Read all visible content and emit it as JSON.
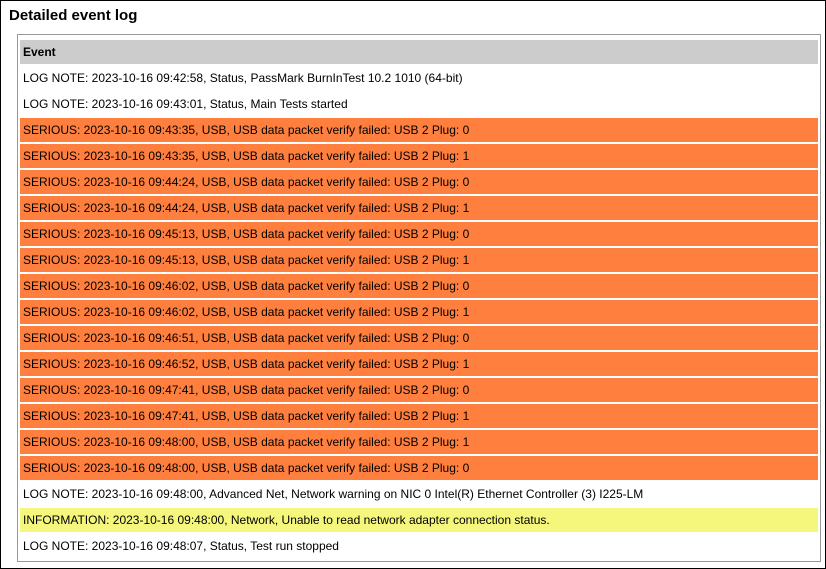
{
  "title": "Detailed event log",
  "table": {
    "header": "Event",
    "rows": [
      {
        "severity": "note",
        "text": "LOG NOTE: 2023-10-16 09:42:58, Status, PassMark BurnInTest 10.2 1010 (64-bit)"
      },
      {
        "severity": "note",
        "text": "LOG NOTE: 2023-10-16 09:43:01, Status, Main Tests started"
      },
      {
        "severity": "serious",
        "text": "SERIOUS: 2023-10-16 09:43:35, USB, USB data packet verify failed: USB 2 Plug: 0"
      },
      {
        "severity": "serious",
        "text": "SERIOUS: 2023-10-16 09:43:35, USB, USB data packet verify failed: USB 2 Plug: 1"
      },
      {
        "severity": "serious",
        "text": "SERIOUS: 2023-10-16 09:44:24, USB, USB data packet verify failed: USB 2 Plug: 0"
      },
      {
        "severity": "serious",
        "text": "SERIOUS: 2023-10-16 09:44:24, USB, USB data packet verify failed: USB 2 Plug: 1"
      },
      {
        "severity": "serious",
        "text": "SERIOUS: 2023-10-16 09:45:13, USB, USB data packet verify failed: USB 2 Plug: 0"
      },
      {
        "severity": "serious",
        "text": "SERIOUS: 2023-10-16 09:45:13, USB, USB data packet verify failed: USB 2 Plug: 1"
      },
      {
        "severity": "serious",
        "text": "SERIOUS: 2023-10-16 09:46:02, USB, USB data packet verify failed: USB 2 Plug: 0"
      },
      {
        "severity": "serious",
        "text": "SERIOUS: 2023-10-16 09:46:02, USB, USB data packet verify failed: USB 2 Plug: 1"
      },
      {
        "severity": "serious",
        "text": "SERIOUS: 2023-10-16 09:46:51, USB, USB data packet verify failed: USB 2 Plug: 0"
      },
      {
        "severity": "serious",
        "text": "SERIOUS: 2023-10-16 09:46:52, USB, USB data packet verify failed: USB 2 Plug: 1"
      },
      {
        "severity": "serious",
        "text": "SERIOUS: 2023-10-16 09:47:41, USB, USB data packet verify failed: USB 2 Plug: 0"
      },
      {
        "severity": "serious",
        "text": "SERIOUS: 2023-10-16 09:47:41, USB, USB data packet verify failed: USB 2 Plug: 1"
      },
      {
        "severity": "serious",
        "text": "SERIOUS: 2023-10-16 09:48:00, USB, USB data packet verify failed: USB 2 Plug: 1"
      },
      {
        "severity": "serious",
        "text": "SERIOUS: 2023-10-16 09:48:00, USB, USB data packet verify failed: USB 2 Plug: 0"
      },
      {
        "severity": "note",
        "text": "LOG NOTE: 2023-10-16 09:48:00, Advanced Net, Network warning on NIC 0 Intel(R) Ethernet Controller (3) I225-LM"
      },
      {
        "severity": "info",
        "text": "INFORMATION: 2023-10-16 09:48:00, Network, Unable to read network adapter connection status."
      },
      {
        "severity": "note",
        "text": "LOG NOTE: 2023-10-16 09:48:07, Status, Test run stopped"
      }
    ]
  },
  "colors": {
    "serious": "#ff7f3f",
    "info": "#f5f77c",
    "header": "#cccccc"
  }
}
